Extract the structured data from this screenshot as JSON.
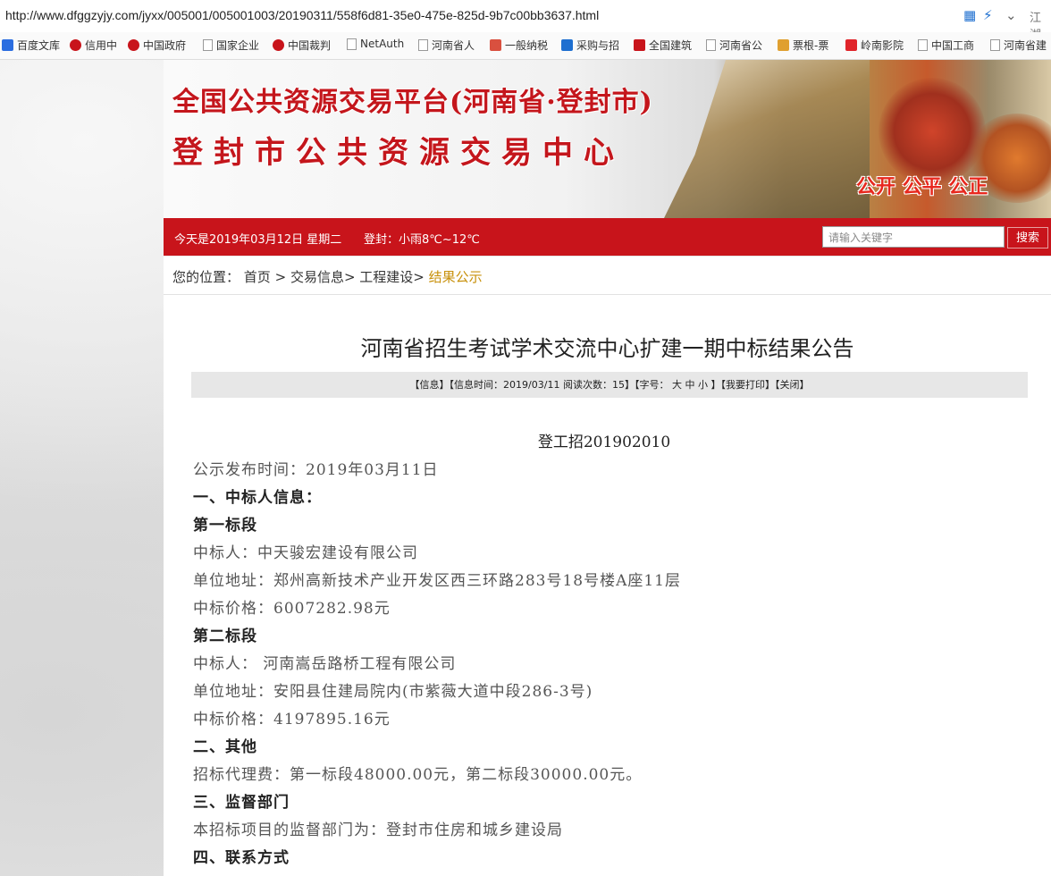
{
  "browser": {
    "url": "http://www.dfggzyjy.com/jyxx/005001/005001003/20190311/558f6d81-35e0-475e-825d-9b7c00bb3637.html",
    "right_text": "江湖"
  },
  "bookmarks": [
    {
      "label": "百度文库",
      "icon": "paw-icon",
      "color": "#2b6de0"
    },
    {
      "label": "信用中",
      "icon": "emblem-icon",
      "color": "#c8141b"
    },
    {
      "label": "中国政府",
      "icon": "emblem-icon",
      "color": "#c8141b"
    },
    {
      "label": "国家企业",
      "icon": "document-icon",
      "color": "#999999"
    },
    {
      "label": "中国裁判",
      "icon": "emblem-icon",
      "color": "#c8141b"
    },
    {
      "label": "NetAuth",
      "icon": "document-icon",
      "color": "#999999"
    },
    {
      "label": "河南省人",
      "icon": "document-icon",
      "color": "#999999"
    },
    {
      "label": "一般纳税",
      "icon": "grid-icon",
      "color": "#d9503f"
    },
    {
      "label": "采购与招",
      "icon": "link-icon",
      "color": "#1e6fd0"
    },
    {
      "label": "全国建筑",
      "icon": "logo-icon",
      "color": "#c8141b"
    },
    {
      "label": "河南省公",
      "icon": "document-icon",
      "color": "#999999"
    },
    {
      "label": "票根-票",
      "icon": "ticket-icon",
      "color": "#e0a030"
    },
    {
      "label": "岭南影院",
      "icon": "play-icon",
      "color": "#e0242a"
    },
    {
      "label": "中国工商",
      "icon": "document-icon",
      "color": "#999999"
    },
    {
      "label": "河南省建",
      "icon": "document-icon",
      "color": "#999999"
    }
  ],
  "header": {
    "line1": "全国公共资源交易平台(河南省·登封市)",
    "line2": "登封市公共资源交易中心",
    "motto": "公开 公平 公正"
  },
  "nav": {
    "date": "今天是2019年03月12日 星期二",
    "weather": "登封：小雨8℃~12℃",
    "search_placeholder": "请输入关键字",
    "search_button": "搜索"
  },
  "breadcrumb": {
    "prefix": "您的位置：",
    "items": [
      "首页",
      "交易信息>",
      "工程建设>"
    ],
    "current": "结果公示"
  },
  "article": {
    "title": "河南省招生考试学术交流中心扩建一期中标结果公告",
    "info": {
      "info_label": "【信息】",
      "time": "【信息时间：2019/03/11",
      "reads": "阅读次数：15】",
      "font_label": "【字号：",
      "font_large": "大",
      "font_medium": "中",
      "font_small": "小",
      "font_end": "】",
      "print": "【我要打印】",
      "close": "【关闭】"
    },
    "lines": [
      {
        "text": "登工招201902010",
        "style": "center"
      },
      {
        "text": "公示发布时间：2019年03月11日",
        "style": ""
      },
      {
        "text": "一、中标人信息：",
        "style": "b"
      },
      {
        "text": "第一标段",
        "style": "b"
      },
      {
        "text": "中标人：中天骏宏建设有限公司",
        "style": ""
      },
      {
        "text": "单位地址：郑州高新技术产业开发区西三环路283号18号楼A座11层",
        "style": ""
      },
      {
        "text": "中标价格：6007282.98元",
        "style": ""
      },
      {
        "text": "第二标段",
        "style": "b"
      },
      {
        "text": "中标人： 河南嵩岳路桥工程有限公司",
        "style": ""
      },
      {
        "text": "单位地址：安阳县住建局院内(市紫薇大道中段286-3号)",
        "style": ""
      },
      {
        "text": "中标价格：4197895.16元",
        "style": ""
      },
      {
        "text": "二、其他",
        "style": "b"
      },
      {
        "text": "招标代理费：第一标段48000.00元，第二标段30000.00元。",
        "style": ""
      },
      {
        "text": "三、监督部门",
        "style": "b"
      },
      {
        "text": "本招标项目的监督部门为：登封市住房和城乡建设局",
        "style": ""
      },
      {
        "text": "四、联系方式",
        "style": "b"
      }
    ]
  }
}
